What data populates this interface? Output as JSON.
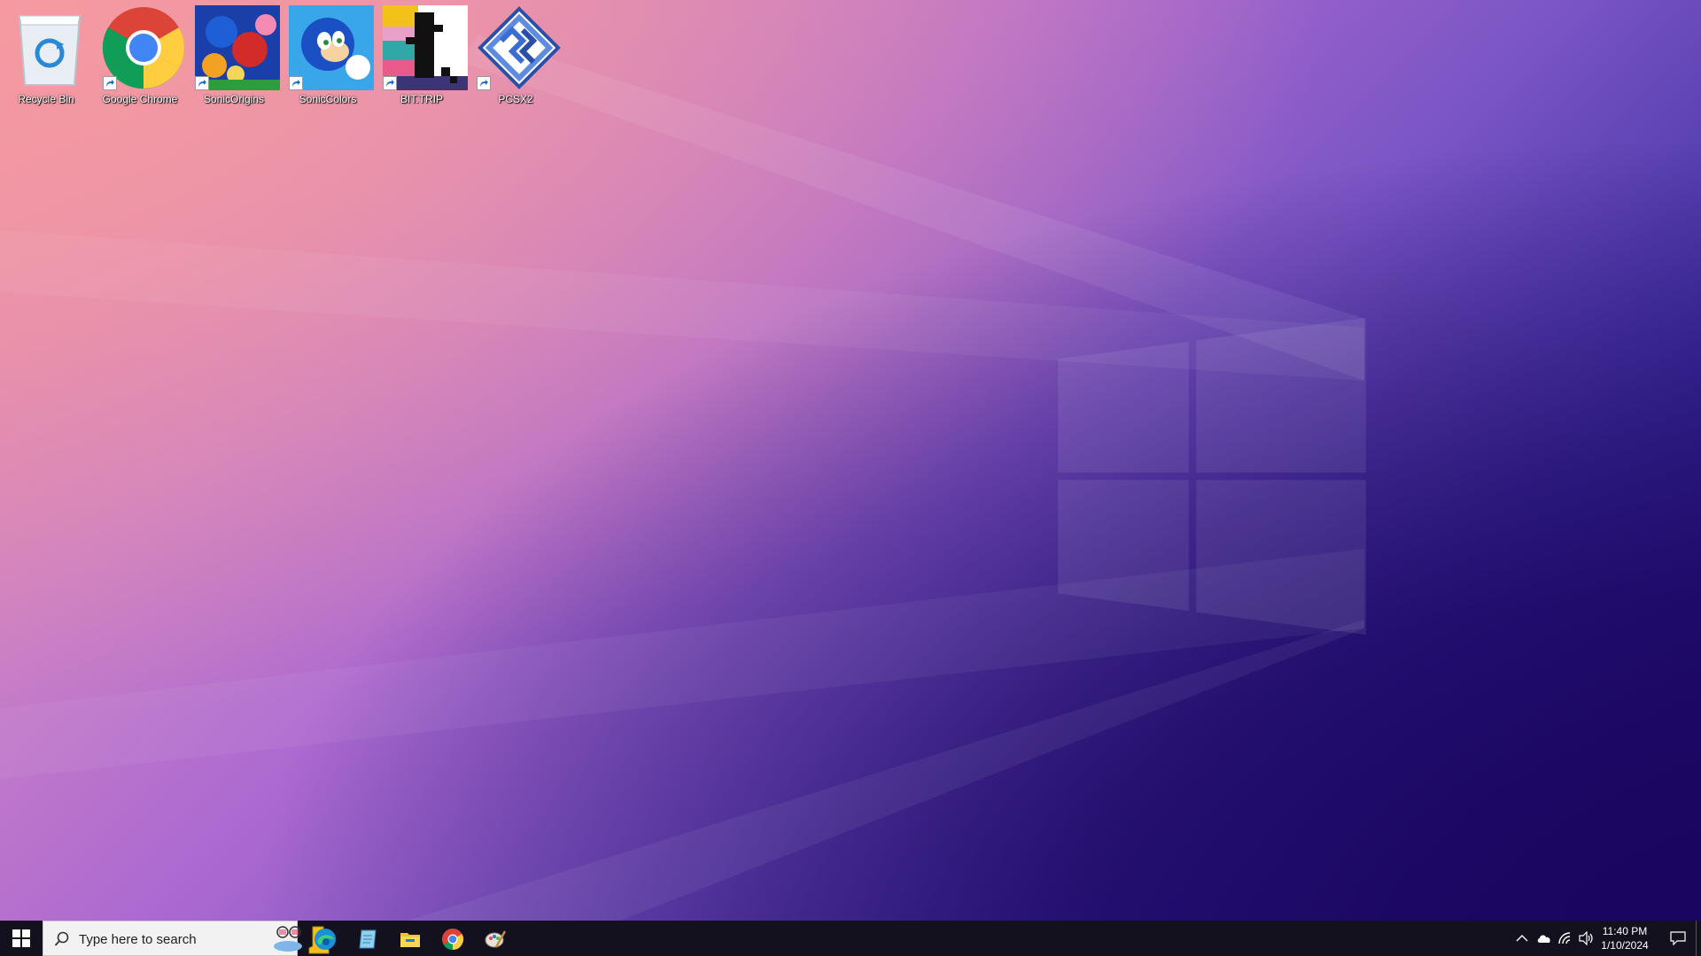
{
  "desktop": {
    "icons": [
      {
        "label": "Recycle Bin",
        "icon": "recycle-bin-icon"
      },
      {
        "label": "Google Chrome",
        "icon": "chrome-icon"
      },
      {
        "label": "SonicOrigins",
        "icon": "sonic-origins-icon"
      },
      {
        "label": "SonicColors",
        "icon": "sonic-colors-icon"
      },
      {
        "label": "BIT.TRIP",
        "icon": "bit-trip-icon"
      },
      {
        "label": "PCSX2",
        "icon": "pcsx2-icon"
      }
    ]
  },
  "taskbar": {
    "search_placeholder": "Type here to search",
    "pinned_apps": [
      "edge-icon",
      "notepad-icon",
      "file-explorer-icon",
      "chrome-icon",
      "paint-icon"
    ],
    "tray": {
      "time": "11:40 PM",
      "date": "1/10/2024"
    }
  },
  "colors": {
    "taskbar": "#14111f",
    "search_box": "#f2f2f2"
  }
}
